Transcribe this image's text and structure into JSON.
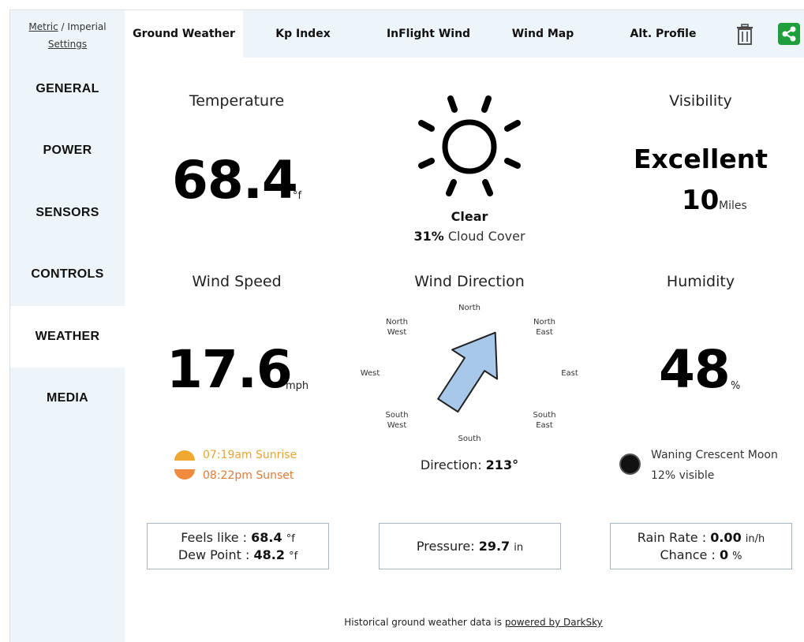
{
  "units": {
    "metric": "Metric",
    "separator": "/",
    "imperial": "Imperial",
    "settings": "Settings"
  },
  "sidebar": {
    "items": [
      {
        "label": "GENERAL"
      },
      {
        "label": "POWER"
      },
      {
        "label": "SENSORS"
      },
      {
        "label": "CONTROLS"
      },
      {
        "label": "WEATHER",
        "active": true
      },
      {
        "label": "MEDIA"
      }
    ]
  },
  "tabs": [
    {
      "label": "Ground Weather",
      "active": true
    },
    {
      "label": "Kp Index"
    },
    {
      "label": "InFlight Wind"
    },
    {
      "label": "Wind Map"
    },
    {
      "label": "Alt. Profile"
    }
  ],
  "icons": {
    "delete": "trash-icon",
    "share": "share-icon",
    "weather": "sun-icon",
    "wind_arrow": "arrow-icon",
    "moon": "moon-icon"
  },
  "colors": {
    "share_green": "#1f9e3c",
    "sunrise": "#f0a830",
    "sunset": "#f08a3c",
    "arrow_fill": "#a7c8e8",
    "sidebar_bg": "#eef5fa"
  },
  "temperature": {
    "label": "Temperature",
    "value": "68.4",
    "unit": "°f"
  },
  "condition": {
    "text": "Clear",
    "cloud_value": "31%",
    "cloud_label": "Cloud Cover"
  },
  "visibility": {
    "label": "Visibility",
    "rating": "Excellent",
    "value": "10",
    "unit": "Miles"
  },
  "wind_speed": {
    "label": "Wind Speed",
    "value": "17.6",
    "unit": "mph"
  },
  "wind_direction": {
    "label": "Wind Direction",
    "degrees": 213,
    "direction_label": "Direction:",
    "direction_value": "213°",
    "compass": {
      "north": "North",
      "north_east_1": "North",
      "north_east_2": "East",
      "east": "East",
      "south_east_1": "South",
      "south_east_2": "East",
      "south": "South",
      "south_west_1": "South",
      "south_west_2": "West",
      "west": "West",
      "north_west_1": "North",
      "north_west_2": "West"
    }
  },
  "humidity": {
    "label": "Humidity",
    "value": "48",
    "unit": "%"
  },
  "sun": {
    "sunrise_time": "07:19am",
    "sunrise_label": "Sunrise",
    "sunset_time": "08:22pm",
    "sunset_label": "Sunset"
  },
  "moon": {
    "phase": "Waning Crescent Moon",
    "visible": "12% visible"
  },
  "feels": {
    "feels_label": "Feels like :",
    "feels_value": "68.4",
    "feels_unit": "°f",
    "dew_label": "Dew Point :",
    "dew_value": "48.2",
    "dew_unit": "°f"
  },
  "pressure": {
    "label": "Pressure:",
    "value": "29.7",
    "unit": "in"
  },
  "rain": {
    "rate_label": "Rain Rate :",
    "rate_value": "0.00",
    "rate_unit": "in/h",
    "chance_label": "Chance :",
    "chance_value": "0",
    "chance_unit": "%"
  },
  "footer": {
    "text": "Historical ground weather data is",
    "link": "powered by DarkSky"
  }
}
